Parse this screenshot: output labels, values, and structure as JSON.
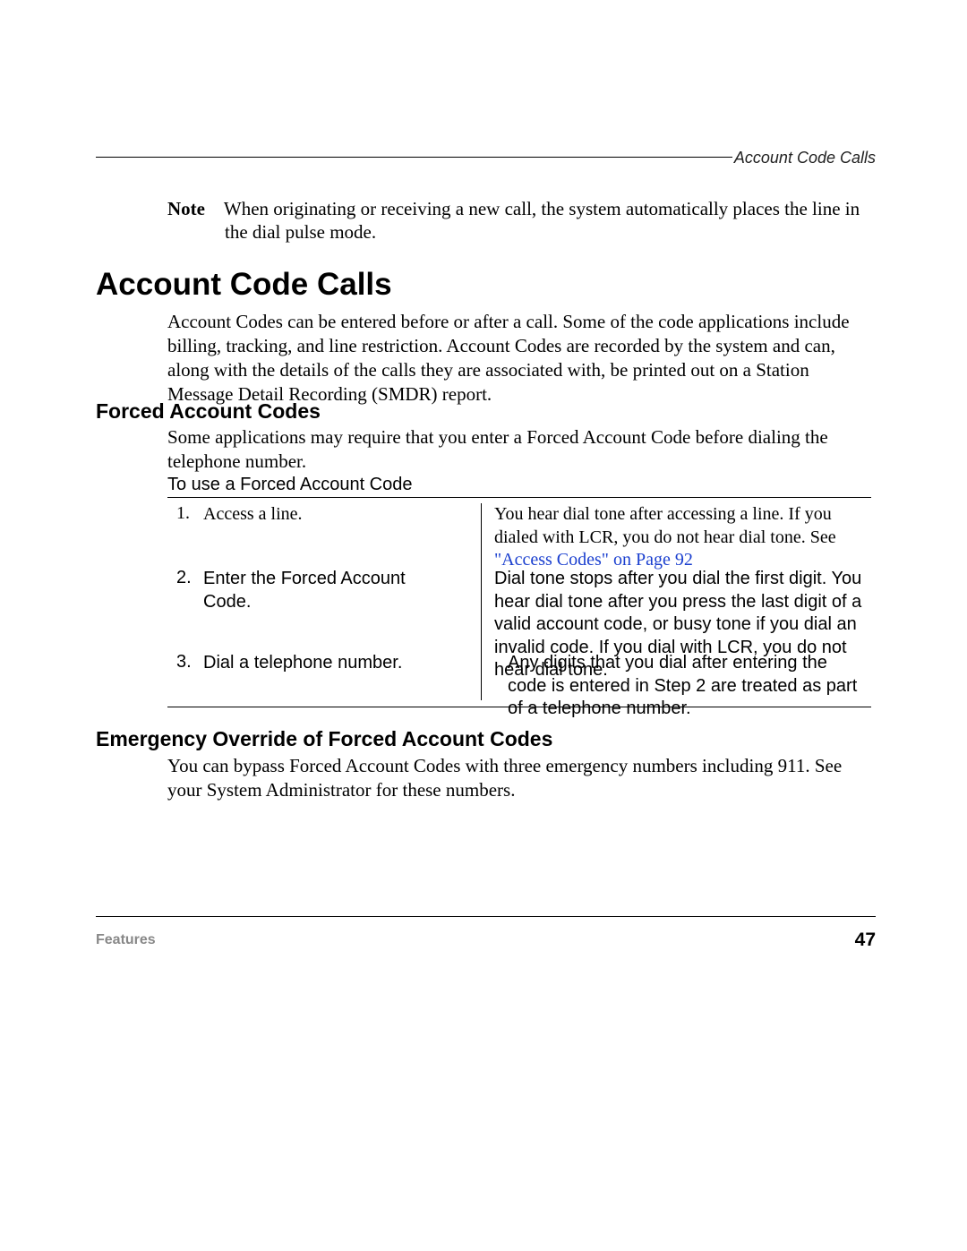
{
  "header": {
    "running_title": "Account Code Calls"
  },
  "note": {
    "label": "Note",
    "text_line1": "When originating or receiving a new call, the system automatically places the line in",
    "text_line2": "the dial pulse mode."
  },
  "section": {
    "title": "Account Code Calls",
    "intro": "Account Codes can be entered before or after a call. Some of the code applications include billing, tracking, and line restriction. Account Codes are recorded by the system and can, along with the details of the calls they are associated with, be printed out on a Station Message Detail Recording (SMDR) report."
  },
  "forced": {
    "heading": "Forced Account Codes",
    "intro": "Some applications may require that you enter a Forced Account Code before dialing the telephone number.",
    "procedure_title": "To use a Forced Account Code",
    "rows": [
      {
        "num": "1.",
        "step": "Access a line.",
        "desc_pre": "You hear dial tone after accessing a line. If you dialed with LCR, you do not hear dial tone. See ",
        "link": "\"Access Codes\" on Page 92"
      },
      {
        "num": "2.",
        "step": "Enter the Forced Account Code.",
        "desc": "Dial tone stops after you dial the first digit. You hear dial tone after you press the last digit of a valid account code, or busy tone if you dial an invalid code. If you dial with LCR, you do not hear dial tone."
      },
      {
        "num": "3.",
        "step": "Dial a telephone number.",
        "desc": "Any digits that you dial after entering the code is entered in Step 2 are treated as part of a telephone number."
      }
    ]
  },
  "emergency": {
    "heading": "Emergency Override of Forced Account Codes",
    "body": "You can bypass Forced Account Codes with three emergency numbers including 911. See your System Administrator for these numbers."
  },
  "footer": {
    "left": "Features",
    "page": "47"
  }
}
